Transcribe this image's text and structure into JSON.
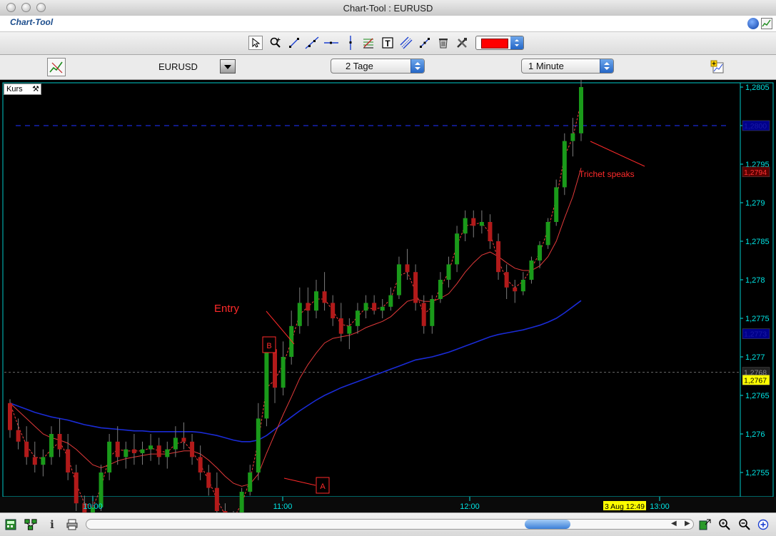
{
  "window": {
    "title": "Chart-Tool : EURUSD"
  },
  "app": {
    "title": "Chart-Tool"
  },
  "toolbar": {
    "tools": [
      "pointer-icon",
      "zoom-icon",
      "trendline-icon",
      "ray-icon",
      "horizontal-line-icon",
      "vertical-line-icon",
      "fibonacci-icon",
      "text-icon",
      "channel-icon",
      "cross-icon",
      "trash-icon",
      "tools-icon"
    ],
    "color": "#ff0000"
  },
  "controls": {
    "symbol": "EURUSD",
    "period": "2 Tage",
    "interval": "1 Minute"
  },
  "chart": {
    "panel_label": "Kurs",
    "y_ticks": [
      "1,2805",
      "1,28",
      "1,2795",
      "1,279",
      "1,2785",
      "1,278",
      "1,2775",
      "1,277",
      "1,2765",
      "1,276",
      "1,2755"
    ],
    "price_tags": [
      {
        "text": "1,2800",
        "color": "#1a1aa8",
        "bg": "#00008b"
      },
      {
        "text": "1,2794",
        "color": "#ff3333",
        "bg": "#5a0000"
      },
      {
        "text": "1,2773",
        "color": "#1a1aa8",
        "bg": "#00008b"
      },
      {
        "text": "1,2768",
        "color": "#888888",
        "bg": "#222222"
      },
      {
        "text": "1,2767",
        "color": "#000000",
        "bg": "#ffff00"
      }
    ],
    "x_ticks": [
      "10:00",
      "11:00",
      "12:00",
      "13:00"
    ],
    "cursor_time": "3 Aug 12:49",
    "annotations": {
      "entry": "Entry",
      "trichet": "Trichet speaks",
      "label_a": "A",
      "label_b": "B"
    },
    "colors": {
      "background": "#000000",
      "border": "#00c8c8",
      "axis": "#00e5e5",
      "up": "#1a9a1a",
      "down": "#b21a1a",
      "ma_short": "#e23a3a",
      "ma_long": "#1a2bd6",
      "annotation": "#ff2a2a"
    }
  },
  "chart_data": {
    "type": "candlestick",
    "title": "",
    "xlabel": "",
    "ylabel": "",
    "x_ticks": [
      "10:00",
      "11:00",
      "12:00",
      "13:00"
    ],
    "y_range": [
      1.2752,
      1.2806
    ],
    "ohlc": [
      [
        1.2764,
        1.27645,
        1.27595,
        1.27605
      ],
      [
        1.27605,
        1.2762,
        1.2758,
        1.2759
      ],
      [
        1.2759,
        1.2761,
        1.2756,
        1.2757
      ],
      [
        1.2757,
        1.2759,
        1.2755,
        1.2756
      ],
      [
        1.2756,
        1.2758,
        1.27545,
        1.2757
      ],
      [
        1.2757,
        1.2761,
        1.2756,
        1.276
      ],
      [
        1.276,
        1.2762,
        1.2757,
        1.2758
      ],
      [
        1.2758,
        1.276,
        1.2754,
        1.2755
      ],
      [
        1.2755,
        1.2756,
        1.275,
        1.2751
      ],
      [
        1.2751,
        1.2752,
        1.2748,
        1.27495
      ],
      [
        1.27495,
        1.2752,
        1.2748,
        1.27505
      ],
      [
        1.27505,
        1.2756,
        1.275,
        1.2755
      ],
      [
        1.2755,
        1.276,
        1.2754,
        1.2759
      ],
      [
        1.2759,
        1.2761,
        1.2756,
        1.2757
      ],
      [
        1.2757,
        1.2759,
        1.27555,
        1.2758
      ],
      [
        1.2758,
        1.276,
        1.2756,
        1.27575
      ],
      [
        1.27575,
        1.2759,
        1.2756,
        1.2758
      ],
      [
        1.2758,
        1.276,
        1.27565,
        1.27585
      ],
      [
        1.27585,
        1.27595,
        1.2756,
        1.2757
      ],
      [
        1.2757,
        1.2759,
        1.27555,
        1.2758
      ],
      [
        1.2758,
        1.2761,
        1.2757,
        1.27595
      ],
      [
        1.27595,
        1.27615,
        1.2758,
        1.2759
      ],
      [
        1.2759,
        1.276,
        1.2756,
        1.2757
      ],
      [
        1.2757,
        1.27585,
        1.2754,
        1.2755
      ],
      [
        1.2755,
        1.2756,
        1.2752,
        1.2753
      ],
      [
        1.2753,
        1.2755,
        1.2749,
        1.275
      ],
      [
        1.275,
        1.2751,
        1.2747,
        1.2748
      ],
      [
        1.2748,
        1.275,
        1.2747,
        1.2749
      ],
      [
        1.2749,
        1.2753,
        1.27485,
        1.27525
      ],
      [
        1.27525,
        1.2756,
        1.2752,
        1.2755
      ],
      [
        1.2755,
        1.2764,
        1.2754,
        1.2762
      ],
      [
        1.2762,
        1.2772,
        1.2761,
        1.2771
      ],
      [
        1.2771,
        1.277,
        1.2764,
        1.2766
      ],
      [
        1.2766,
        1.2772,
        1.2765,
        1.277
      ],
      [
        1.277,
        1.2776,
        1.2769,
        1.2774
      ],
      [
        1.2774,
        1.2779,
        1.2773,
        1.2777
      ],
      [
        1.2777,
        1.2779,
        1.2774,
        1.2776
      ],
      [
        1.2776,
        1.278,
        1.2775,
        1.27785
      ],
      [
        1.27785,
        1.2781,
        1.2776,
        1.2777
      ],
      [
        1.2777,
        1.2778,
        1.2774,
        1.2775
      ],
      [
        1.2775,
        1.2777,
        1.2772,
        1.2773
      ],
      [
        1.2773,
        1.2775,
        1.2771,
        1.2774
      ],
      [
        1.2774,
        1.2777,
        1.2773,
        1.2776
      ],
      [
        1.2776,
        1.2778,
        1.2775,
        1.2777
      ],
      [
        1.2777,
        1.2778,
        1.27755,
        1.2776
      ],
      [
        1.2776,
        1.27775,
        1.2775,
        1.27765
      ],
      [
        1.27765,
        1.2779,
        1.2776,
        1.2778
      ],
      [
        1.2778,
        1.2783,
        1.27775,
        1.2782
      ],
      [
        1.2782,
        1.2784,
        1.278,
        1.2781
      ],
      [
        1.2781,
        1.2782,
        1.2776,
        1.2777
      ],
      [
        1.2777,
        1.2778,
        1.2773,
        1.2774
      ],
      [
        1.2774,
        1.2778,
        1.2773,
        1.27775
      ],
      [
        1.27775,
        1.2781,
        1.2777,
        1.278
      ],
      [
        1.278,
        1.2783,
        1.2779,
        1.2782
      ],
      [
        1.2782,
        1.2787,
        1.2781,
        1.2786
      ],
      [
        1.2786,
        1.2789,
        1.2785,
        1.2788
      ],
      [
        1.2788,
        1.2789,
        1.27855,
        1.2787
      ],
      [
        1.2787,
        1.2789,
        1.2786,
        1.27875
      ],
      [
        1.27875,
        1.27885,
        1.2784,
        1.2785
      ],
      [
        1.2785,
        1.2786,
        1.278,
        1.2781
      ],
      [
        1.2781,
        1.2782,
        1.27775,
        1.2779
      ],
      [
        1.2779,
        1.278,
        1.2777,
        1.27785
      ],
      [
        1.27785,
        1.2781,
        1.2778,
        1.278
      ],
      [
        1.278,
        1.2783,
        1.27795,
        1.27825
      ],
      [
        1.27825,
        1.2785,
        1.27815,
        1.27845
      ],
      [
        1.27845,
        1.2788,
        1.2784,
        1.27875
      ],
      [
        1.27875,
        1.2793,
        1.2787,
        1.2792
      ],
      [
        1.2792,
        1.2799,
        1.2791,
        1.2798
      ],
      [
        1.2798,
        1.2801,
        1.2796,
        1.2799
      ],
      [
        1.2799,
        1.2806,
        1.2798,
        1.2805
      ]
    ],
    "series": [
      {
        "type": "line",
        "values": [
          1.2764,
          1.2761,
          1.27585,
          1.2757,
          1.27568,
          1.2758,
          1.2759,
          1.2757,
          1.27535,
          1.2751,
          1.27505,
          1.2753,
          1.2757,
          1.2758,
          1.27578,
          1.27578,
          1.27578,
          1.27582,
          1.27578,
          1.27576,
          1.27587,
          1.2759,
          1.27578,
          1.2756,
          1.2754,
          1.27515,
          1.27495,
          1.2749,
          1.2751,
          1.2754,
          1.2759,
          1.2766,
          1.2767,
          1.2769,
          1.2772,
          1.27755,
          1.27765,
          1.27775,
          1.27775,
          1.2776,
          1.27742,
          1.2774,
          1.27752,
          1.27764,
          1.27762,
          1.27764,
          1.27775,
          1.27805,
          1.2781,
          1.27785,
          1.27755,
          1.27765,
          1.2779,
          1.2781,
          1.27845,
          1.2787,
          1.27872,
          1.27874,
          1.2786,
          1.27825,
          1.278,
          1.2779,
          1.27798,
          1.27815,
          1.27835,
          1.27865,
          1.27905,
          1.2796,
          1.27985,
          1.2803
        ]
      },
      {
        "type": "line",
        "values": [
          1.2764,
          1.2763,
          1.2762,
          1.2761,
          1.276,
          1.27595,
          1.27592,
          1.27588,
          1.2758,
          1.2757,
          1.2756,
          1.27556,
          1.2756,
          1.27565,
          1.27568,
          1.2757,
          1.27572,
          1.27574,
          1.27574,
          1.27574,
          1.27576,
          1.27578,
          1.27578,
          1.27574,
          1.27566,
          1.27556,
          1.27545,
          1.27536,
          1.27532,
          1.27535,
          1.27548,
          1.27575,
          1.276,
          1.27625,
          1.27648,
          1.27672,
          1.2769,
          1.27705,
          1.27718,
          1.27724,
          1.27726,
          1.27728,
          1.27732,
          1.27738,
          1.27742,
          1.27746,
          1.27752,
          1.27762,
          1.27772,
          1.27775,
          1.27772,
          1.27772,
          1.27776,
          1.27782,
          1.27795,
          1.2781,
          1.27822,
          1.27832,
          1.27836,
          1.2783,
          1.27822,
          1.27815,
          1.27812,
          1.27812,
          1.27818,
          1.2783,
          1.2785,
          1.2788,
          1.27908,
          1.27945
        ]
      },
      {
        "type": "line",
        "values": [
          1.2764,
          1.27636,
          1.27632,
          1.27628,
          1.27625,
          1.27622,
          1.2762,
          1.27618,
          1.27615,
          1.27612,
          1.2761,
          1.27608,
          1.27607,
          1.27606,
          1.27605,
          1.27604,
          1.27604,
          1.27603,
          1.27603,
          1.27603,
          1.27603,
          1.27603,
          1.27603,
          1.27602,
          1.276,
          1.27598,
          1.27595,
          1.27592,
          1.2759,
          1.2759,
          1.27592,
          1.27598,
          1.27606,
          1.27614,
          1.27622,
          1.2763,
          1.27637,
          1.27644,
          1.2765,
          1.27655,
          1.2766,
          1.27664,
          1.27668,
          1.27672,
          1.27676,
          1.2768,
          1.27684,
          1.27688,
          1.27692,
          1.27696,
          1.27698,
          1.277,
          1.27703,
          1.27706,
          1.2771,
          1.27714,
          1.27718,
          1.27722,
          1.27726,
          1.27729,
          1.27731,
          1.27733,
          1.27735,
          1.27738,
          1.27741,
          1.27745,
          1.2775,
          1.27757,
          1.27765,
          1.27773
        ]
      }
    ],
    "levels": [
      1.28,
      1.2768
    ]
  }
}
